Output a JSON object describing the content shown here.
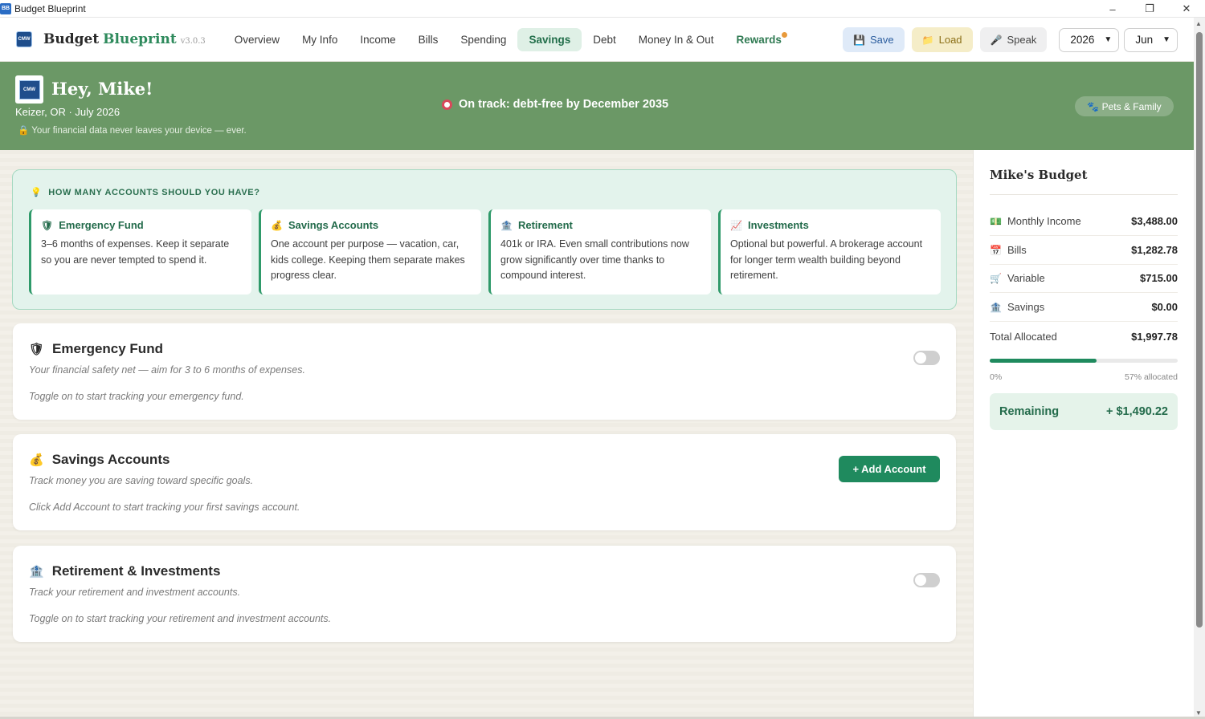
{
  "window": {
    "icon_text": "BB",
    "title": "Budget Blueprint",
    "controls": {
      "minimize": "–",
      "maximize": "❐",
      "close": "✕"
    }
  },
  "nav": {
    "logo_text": "CMW",
    "brand_part1": "Budget",
    "brand_part2": "Blueprint",
    "version": "v3.0.3",
    "links": [
      "Overview",
      "My Info",
      "Income",
      "Bills",
      "Spending",
      "Savings",
      "Debt",
      "Money In & Out",
      "Rewards"
    ],
    "active": "Savings",
    "save_label": "Save",
    "load_label": "Load",
    "speak_label": "Speak",
    "year": "2026",
    "month": "Jun"
  },
  "banner": {
    "avatar_text": "CMW",
    "greeting": "Hey, Mike!",
    "location": "Keizer, OR · July 2026",
    "privacy": "🔒 Your financial data never leaves your device — ever.",
    "status": "On track: debt-free by December 2035",
    "pets_button": "🐾 Pets & Family",
    "bg_color": "#6b9866"
  },
  "tips": {
    "heading": "HOW MANY ACCOUNTS SHOULD YOU HAVE?",
    "items": [
      {
        "icon": "shield-icon",
        "glyph": "🛡",
        "title": "Emergency Fund",
        "text": "3–6 months of expenses. Keep it separate so you are never tempted to spend it."
      },
      {
        "icon": "money-bag-icon",
        "glyph": "💰",
        "title": "Savings Accounts",
        "text": "One account per purpose — vacation, car, kids college. Keeping them separate makes progress clear."
      },
      {
        "icon": "bank-icon",
        "glyph": "🏦",
        "title": "Retirement",
        "text": "401k or IRA. Even small contributions now grow significantly over time thanks to compound interest."
      },
      {
        "icon": "chart-icon",
        "glyph": "📈",
        "title": "Investments",
        "text": "Optional but powerful. A brokerage account for longer term wealth building beyond retirement."
      }
    ]
  },
  "cards": {
    "emergency": {
      "glyph": "🛡",
      "title": "Emergency Fund",
      "subtitle": "Your financial safety net — aim for 3 to 6 months of expenses.",
      "hint": "Toggle on to start tracking your emergency fund.",
      "enabled": false
    },
    "savings": {
      "glyph": "💰",
      "title": "Savings Accounts",
      "subtitle": "Track money you are saving toward specific goals.",
      "hint": "Click Add Account to start tracking your first savings account.",
      "add_button": "+ Add Account"
    },
    "retirement": {
      "glyph": "🏦",
      "title": "Retirement & Investments",
      "subtitle": "Track your retirement and investment accounts.",
      "hint": "Toggle on to start tracking your retirement and investment accounts.",
      "enabled": false
    }
  },
  "sidebar": {
    "title": "Mike's Budget",
    "rows": [
      {
        "glyph": "💵",
        "label": "Monthly Income",
        "value": "$3,488.00"
      },
      {
        "glyph": "📅",
        "label": "Bills",
        "value": "$1,282.78"
      },
      {
        "glyph": "🛒",
        "label": "Variable",
        "value": "$715.00"
      },
      {
        "glyph": "🏦",
        "label": "Savings",
        "value": "$0.00"
      }
    ],
    "total_label": "Total Allocated",
    "total_value": "$1,997.78",
    "progress_fraction": 0.57,
    "progress_min_label": "0%",
    "progress_label": "57% allocated",
    "remaining_label": "Remaining",
    "remaining_value": "+ $1,490.22",
    "accent": "#1f8a5e"
  }
}
